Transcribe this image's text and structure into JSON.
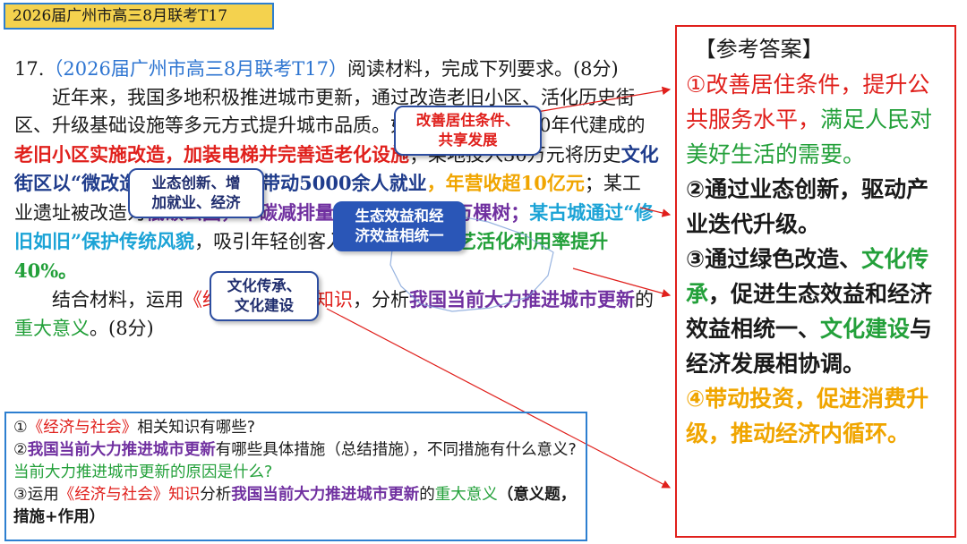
{
  "title_tab": "2026届广州市高三8月联考T17",
  "question": {
    "number": "17.",
    "source": "（2026届广州市高三8月联考T17）",
    "instruction": "阅读材料，完成下列要求。(8分)",
    "material": [
      {
        "text": "近年来，我国多地积极推进城市更新，通过改造老旧小区、活化历史街区、升级基础设施等多元方式提升城市品质。如某市对",
        "style": "plain"
      },
      {
        "text": "20世纪80年代建成的",
        "style": "plain"
      },
      {
        "text": "老旧小区实施改造，加装电梯并完善适老化设施",
        "style": "red"
      },
      {
        "text": "；某地投入30万元将历史",
        "style": "plain"
      },
      {
        "text": "文化街区以“微改造”引入新业态，带动5000余人就业",
        "style": "navy"
      },
      {
        "text": "，年营收超10亿元",
        "style": "orange"
      },
      {
        "text": "；某工业遗址被改造为",
        "style": "plain"
      },
      {
        "text": "低碳公园，年碳减排量相当于种植20万棵树",
        "style": "purple"
      },
      {
        "text": "；",
        "style": "purple"
      },
      {
        "text": "某古城通过“修旧如旧”保护传统风貌",
        "style": "cyan"
      },
      {
        "text": "，吸引年轻创客入驻，",
        "style": "plain"
      },
      {
        "text": "使非遗技艺活化利用率提升40%。",
        "style": "green"
      }
    ],
    "task_prefix": "结合材料，运用",
    "task_book": "《经济与社会》知识",
    "task_mid": "，分析",
    "task_topic": "我国当前大力推进城市更新",
    "task_de": "的",
    "task_meaning": "重大意义",
    "task_suffix": "。(8分)"
  },
  "callouts": {
    "c1": [
      "改善居住条件、",
      "共享发展"
    ],
    "c2": [
      "业态创新、增",
      "加就业、经济"
    ],
    "c3": [
      "生态效益和经",
      "济效益相统一"
    ],
    "c4": [
      "文化传承、",
      "文化建设"
    ]
  },
  "hints": {
    "h1_num": "①",
    "h1_book": "《经济与社会》",
    "h1_rest": "相关知识有哪些?",
    "h2_num": "②",
    "h2_topic": "我国当前大力推进城市更新",
    "h2_mid": "有哪些具体措施（总结措施），不同措施有什么意义?",
    "h2_green": "当前大力推进城市更新的原因是什么?",
    "h3_num": "③运用",
    "h3_book": "《经济与社会》知识",
    "h3_mid": "分析",
    "h3_topic": "我国当前大力推进城市更新",
    "h3_de": "的",
    "h3_meaning": "重大意义",
    "h3_tail": "（意义题，措施+作用）"
  },
  "answer": {
    "title": "【参考答案】",
    "a1_red": "①改善居住条件，提升公共服务水平，",
    "a1_green": "满足人民对美好生活的需要。",
    "a2": "②通过业态创新，驱动产业迭代升级。",
    "a3_pre": "③通过绿色改造、",
    "a3_g1": "文化传承",
    "a3_mid": "，促进生态效益和经济效益相统一、",
    "a3_g2": "文化建设",
    "a3_end": "与经济发展相协调。",
    "a4": "④带动投资，促进消费升级，推动经济内循环。"
  },
  "colors": {
    "red": "#e0201c",
    "green": "#23a03a",
    "orange": "#f0a500",
    "purple": "#7030a0",
    "navy": "#1f3c8c",
    "blue_border": "#2d7fd0",
    "tab_yellow": "#f4d24e"
  }
}
